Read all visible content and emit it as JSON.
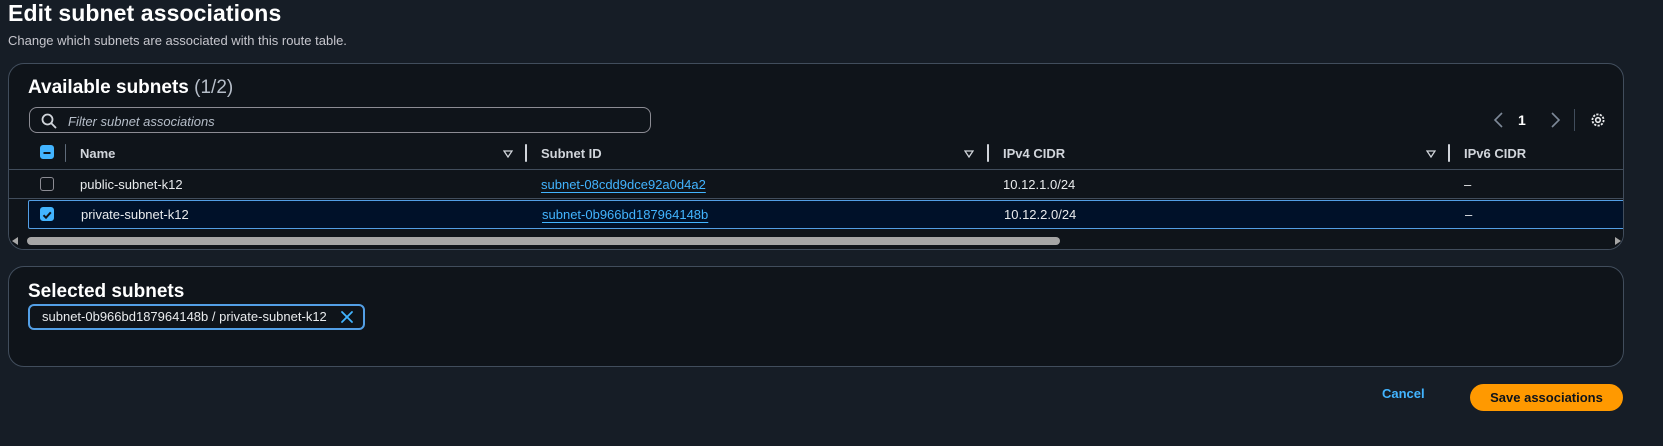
{
  "page": {
    "title": "Edit subnet associations",
    "description": "Change which subnets are associated with this route table."
  },
  "available": {
    "heading": "Available subnets",
    "count": "(1/2)",
    "filter_placeholder": "Filter subnet associations",
    "current_page": "1",
    "columns": [
      "Name",
      "Subnet ID",
      "IPv4 CIDR",
      "IPv6 CIDR"
    ],
    "rows": [
      {
        "name": "public-subnet-k12",
        "subnet_id": "subnet-08cdd9dce92a0d4a2",
        "ipv4": "10.12.1.0/24",
        "ipv6": "–",
        "selected": false
      },
      {
        "name": "private-subnet-k12",
        "subnet_id": "subnet-0b966bd187964148b",
        "ipv4": "10.12.2.0/24",
        "ipv6": "–",
        "selected": true
      }
    ]
  },
  "selected": {
    "heading": "Selected subnets",
    "tokens": [
      "subnet-0b966bd187964148b / private-subnet-k12"
    ]
  },
  "actions": {
    "cancel": "Cancel",
    "save": "Save associations"
  },
  "colors": {
    "background": "#161d26",
    "panel": "#0f141a",
    "link": "#42b4ff",
    "selected_row_bg": "#001129",
    "primary_button": "#ff9900"
  }
}
